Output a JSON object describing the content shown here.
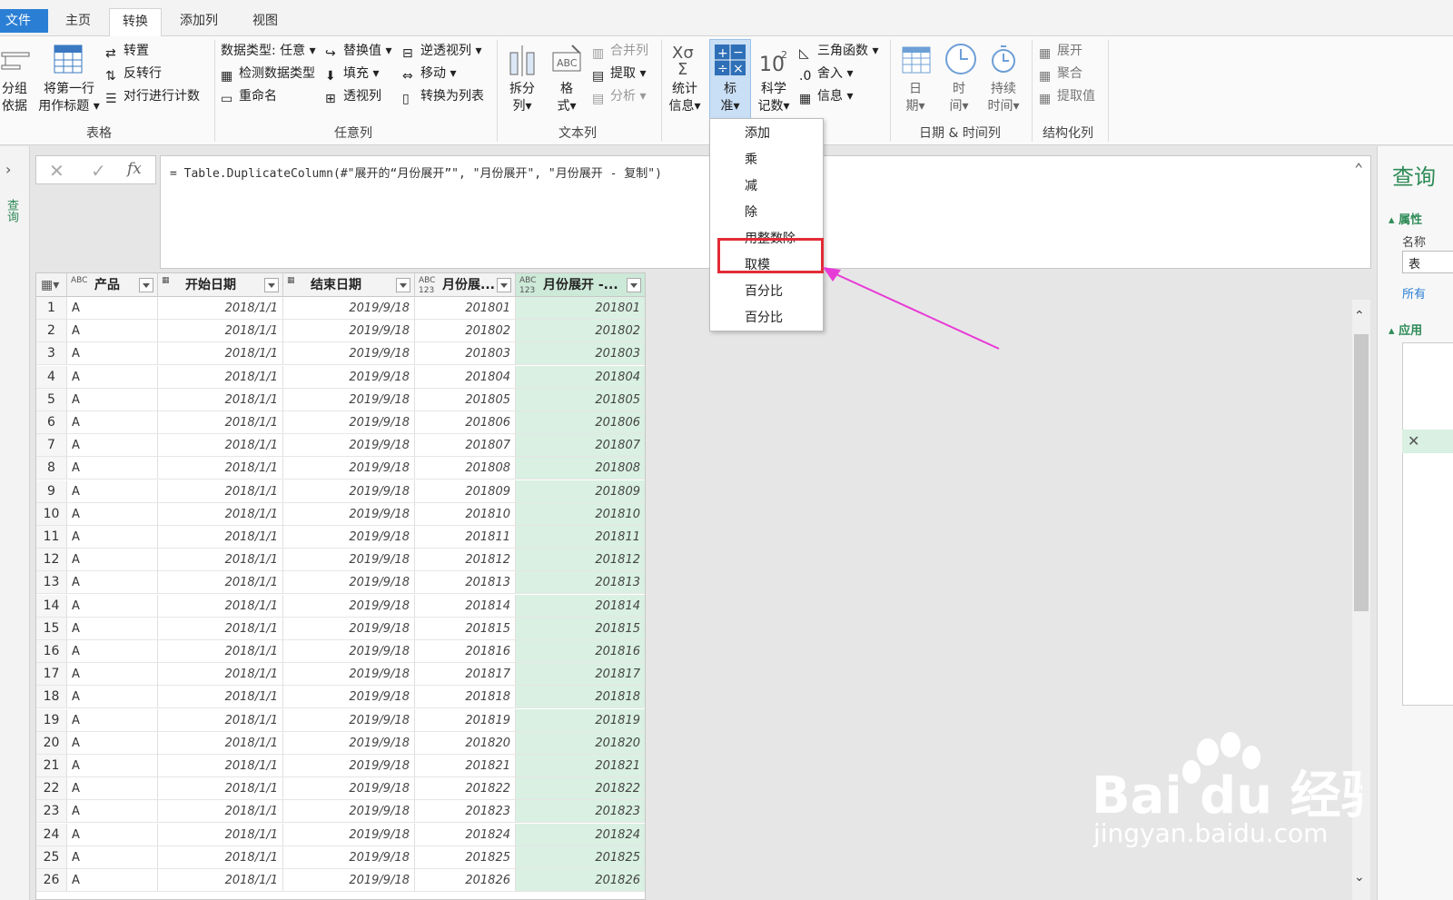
{
  "tabs": {
    "file": "文件",
    "home": "主页",
    "transform": "转换",
    "add_column": "添加列",
    "view": "视图"
  },
  "ribbon": {
    "table_group": {
      "label": "表格",
      "group_by": [
        "分组",
        "依据"
      ],
      "first_row_header": [
        "将第一行",
        "用作标题"
      ],
      "transpose": "转置",
      "reverse_rows": "反转行",
      "count_rows": "对行进行计数"
    },
    "any_column_group": {
      "label": "任意列",
      "data_type": "数据类型: 任意",
      "detect_type": "检测数据类型",
      "rename": "重命名",
      "replace_values": "替换值",
      "fill": "填充",
      "pivot_column": "透视列",
      "unpivot": "逆透视列",
      "move": "移动",
      "to_list": "转换为列表"
    },
    "text_column_group": {
      "label": "文本列",
      "split": [
        "拆分",
        "列"
      ],
      "format": [
        "格",
        "式"
      ],
      "merge_columns": "合并列",
      "extract": "提取",
      "parse": "分析"
    },
    "number_column_group": {
      "statistics": [
        "统计",
        "信息"
      ],
      "standard": [
        "标",
        "准"
      ],
      "scientific": [
        "科学",
        "记数"
      ],
      "trigonometry": "三角函数",
      "rounding": "舍入",
      "information": "信息"
    },
    "datetime_group": {
      "label": "日期 & 时间列",
      "date": [
        "日",
        "期"
      ],
      "time": [
        "时",
        "间"
      ],
      "duration": [
        "持续",
        "时间"
      ]
    },
    "structured_group": {
      "label": "结构化列",
      "expand": "展开",
      "aggregate": "聚合",
      "extract_values": "提取值"
    }
  },
  "formula": "= Table.DuplicateColumn(#\"展开的“月份展开”\", \"月份展开\", \"月份展开 - 复制\")",
  "left_pane_label": "查询",
  "right_pane": {
    "title": "查询",
    "properties": "属性",
    "name": "名称",
    "name_value": "表",
    "all_props": "所有",
    "applied": "应用"
  },
  "menu": {
    "items": [
      "添加",
      "乘",
      "减",
      "除",
      "用整数除",
      "取模",
      "百分比",
      "百分比"
    ],
    "highlighted": "取模"
  },
  "table": {
    "columns": [
      {
        "type": "ABC",
        "name": "产品"
      },
      {
        "type": "date",
        "name": "开始日期"
      },
      {
        "type": "date",
        "name": "结束日期"
      },
      {
        "type": "ABC123",
        "name": "月份展..."
      },
      {
        "type": "ABC123",
        "name": "月份展开 -..."
      }
    ],
    "rows": [
      [
        "1",
        "A",
        "2018/1/1",
        "2019/9/18",
        "201801",
        "201801"
      ],
      [
        "2",
        "A",
        "2018/1/1",
        "2019/9/18",
        "201802",
        "201802"
      ],
      [
        "3",
        "A",
        "2018/1/1",
        "2019/9/18",
        "201803",
        "201803"
      ],
      [
        "4",
        "A",
        "2018/1/1",
        "2019/9/18",
        "201804",
        "201804"
      ],
      [
        "5",
        "A",
        "2018/1/1",
        "2019/9/18",
        "201805",
        "201805"
      ],
      [
        "6",
        "A",
        "2018/1/1",
        "2019/9/18",
        "201806",
        "201806"
      ],
      [
        "7",
        "A",
        "2018/1/1",
        "2019/9/18",
        "201807",
        "201807"
      ],
      [
        "8",
        "A",
        "2018/1/1",
        "2019/9/18",
        "201808",
        "201808"
      ],
      [
        "9",
        "A",
        "2018/1/1",
        "2019/9/18",
        "201809",
        "201809"
      ],
      [
        "10",
        "A",
        "2018/1/1",
        "2019/9/18",
        "201810",
        "201810"
      ],
      [
        "11",
        "A",
        "2018/1/1",
        "2019/9/18",
        "201811",
        "201811"
      ],
      [
        "12",
        "A",
        "2018/1/1",
        "2019/9/18",
        "201812",
        "201812"
      ],
      [
        "13",
        "A",
        "2018/1/1",
        "2019/9/18",
        "201813",
        "201813"
      ],
      [
        "14",
        "A",
        "2018/1/1",
        "2019/9/18",
        "201814",
        "201814"
      ],
      [
        "15",
        "A",
        "2018/1/1",
        "2019/9/18",
        "201815",
        "201815"
      ],
      [
        "16",
        "A",
        "2018/1/1",
        "2019/9/18",
        "201816",
        "201816"
      ],
      [
        "17",
        "A",
        "2018/1/1",
        "2019/9/18",
        "201817",
        "201817"
      ],
      [
        "18",
        "A",
        "2018/1/1",
        "2019/9/18",
        "201818",
        "201818"
      ],
      [
        "19",
        "A",
        "2018/1/1",
        "2019/9/18",
        "201819",
        "201819"
      ],
      [
        "20",
        "A",
        "2018/1/1",
        "2019/9/18",
        "201820",
        "201820"
      ],
      [
        "21",
        "A",
        "2018/1/1",
        "2019/9/18",
        "201821",
        "201821"
      ],
      [
        "22",
        "A",
        "2018/1/1",
        "2019/9/18",
        "201822",
        "201822"
      ],
      [
        "23",
        "A",
        "2018/1/1",
        "2019/9/18",
        "201823",
        "201823"
      ],
      [
        "24",
        "A",
        "2018/1/1",
        "2019/9/18",
        "201824",
        "201824"
      ],
      [
        "25",
        "A",
        "2018/1/1",
        "2019/9/18",
        "201825",
        "201825"
      ],
      [
        "26",
        "A",
        "2018/1/1",
        "2019/9/18",
        "201826",
        "201826"
      ]
    ]
  },
  "watermark": {
    "brand": "Bai du 经验",
    "url": "jingyan.baidu.com"
  },
  "colors": {
    "accent": "#2a7fd5",
    "selected_col": "#d9f0e2",
    "highlight": "#e32b36",
    "arrow": "#e83ad6"
  }
}
